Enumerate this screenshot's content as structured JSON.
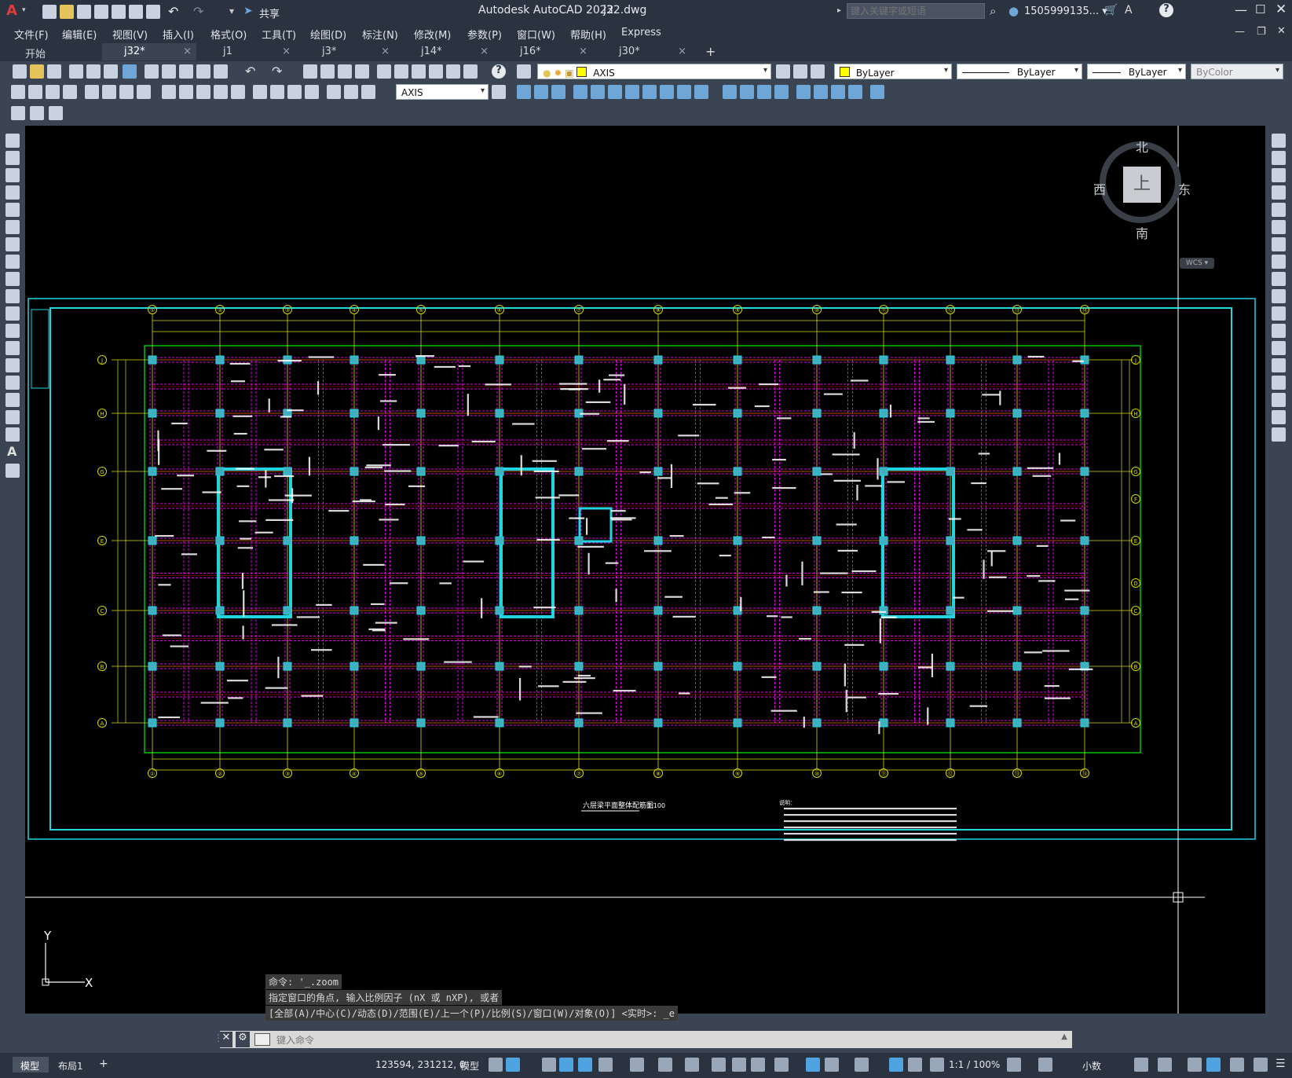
{
  "app": {
    "title": "Autodesk AutoCAD 2022",
    "filename": "j32.dwg",
    "search_placeholder": "键入关键字或短语",
    "user": "1505999135... ▾",
    "share": "共享",
    "logo": "A"
  },
  "menu": [
    "文件(F)",
    "编辑(E)",
    "视图(V)",
    "插入(I)",
    "格式(O)",
    "工具(T)",
    "绘图(D)",
    "标注(N)",
    "修改(M)",
    "参数(P)",
    "窗口(W)",
    "帮助(H)",
    "Express"
  ],
  "tabs": [
    {
      "label": "开始",
      "close": ""
    },
    {
      "label": "j32*",
      "close": "×"
    },
    {
      "label": "j1",
      "close": "×"
    },
    {
      "label": "j3*",
      "close": "×"
    },
    {
      "label": "j14*",
      "close": "×"
    },
    {
      "label": "j16*",
      "close": "×"
    },
    {
      "label": "j30*",
      "close": "×"
    }
  ],
  "add_tab": "+",
  "layer_combo": "AXIS",
  "dim_layer_combo": "AXIS",
  "color_combo": "ByLayer",
  "linetype_combo": "ByLayer",
  "lineweight_combo": "ByLayer",
  "plotstyle_combo": "ByColor",
  "viewcube": {
    "north": "北",
    "south": "南",
    "east": "东",
    "west": "西",
    "top": "上",
    "wcs": "WCS ▾"
  },
  "ucs": {
    "y": "Y",
    "x": "X"
  },
  "drawing": {
    "top_axes": [
      "①",
      "②",
      "③",
      "④",
      "⑤",
      "⑥",
      "⑦",
      "⑧",
      "⑨",
      "⑩",
      "⑪",
      "⑫",
      "⑬",
      "⑭"
    ],
    "row_axes": [
      "J",
      "H",
      "G",
      "E",
      "C",
      "B",
      "A"
    ],
    "right_row_axes": [
      "J",
      "H",
      "G",
      "F",
      "E",
      "D",
      "C",
      "B",
      "A"
    ],
    "plan_title": "六层梁平面整体配筋图",
    "plan_scale": "1:100",
    "notes_title": "说明："
  },
  "command": {
    "history": [
      "命令: '_.zoom",
      "指定窗口的角点, 输入比例因子 (nX 或 nXP), 或者",
      "[全部(A)/中心(C)/动态(D)/范围(E)/上一个(P)/比例(S)/窗口(W)/对象(O)] <实时>: _e"
    ],
    "placeholder": "键入命令"
  },
  "status": {
    "model_tab": "模型",
    "layout_tab": "布局1",
    "add": "+",
    "coords": "123594, 231212, 0",
    "space": "模型",
    "scale": "1:1 / 100%",
    "units": "小数"
  }
}
